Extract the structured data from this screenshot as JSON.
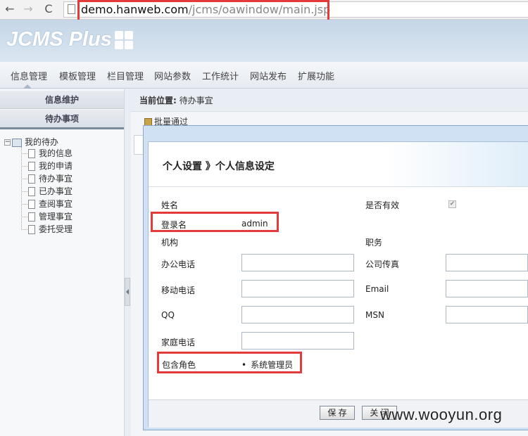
{
  "browser": {
    "url_host": "demo.hanweb.com",
    "url_path": "/jcms/oawindow/main.jsp",
    "nav": {
      "back": "←",
      "forward": "→",
      "reload": "C"
    }
  },
  "app": {
    "logo": "JCMS Plus"
  },
  "menu": [
    "信息管理",
    "模板管理",
    "栏目管理",
    "网站参数",
    "工作统计",
    "网站发布",
    "扩展功能"
  ],
  "sidebar": {
    "tabs": [
      "信息维护",
      "待办事项"
    ],
    "tree_root": "我的待办",
    "tree_items": [
      "我的信息",
      "我的申请",
      "待办事宜",
      "已办事宜",
      "查阅事宜",
      "管理事宜",
      "委托受理"
    ]
  },
  "breadcrumb": {
    "label": "当前位置:",
    "value": "待办事宜"
  },
  "toolbar": {
    "batch": "批量通过"
  },
  "dialog": {
    "title": "个人设置 》个人信息设定",
    "fields": {
      "name": "姓名",
      "active": "是否有效",
      "login": "登录名",
      "login_value": "admin",
      "org": "机构",
      "position": "职务",
      "office_phone": "办公电话",
      "fax": "公司传真",
      "mobile": "移动电话",
      "email": "Email",
      "qq": "QQ",
      "msn": "MSN",
      "home_phone": "家庭电话",
      "roles": "包含角色",
      "role_value": "系统管理员"
    },
    "save": "保 存",
    "close": "关 闭"
  },
  "watermark": "www.wooyun.org"
}
